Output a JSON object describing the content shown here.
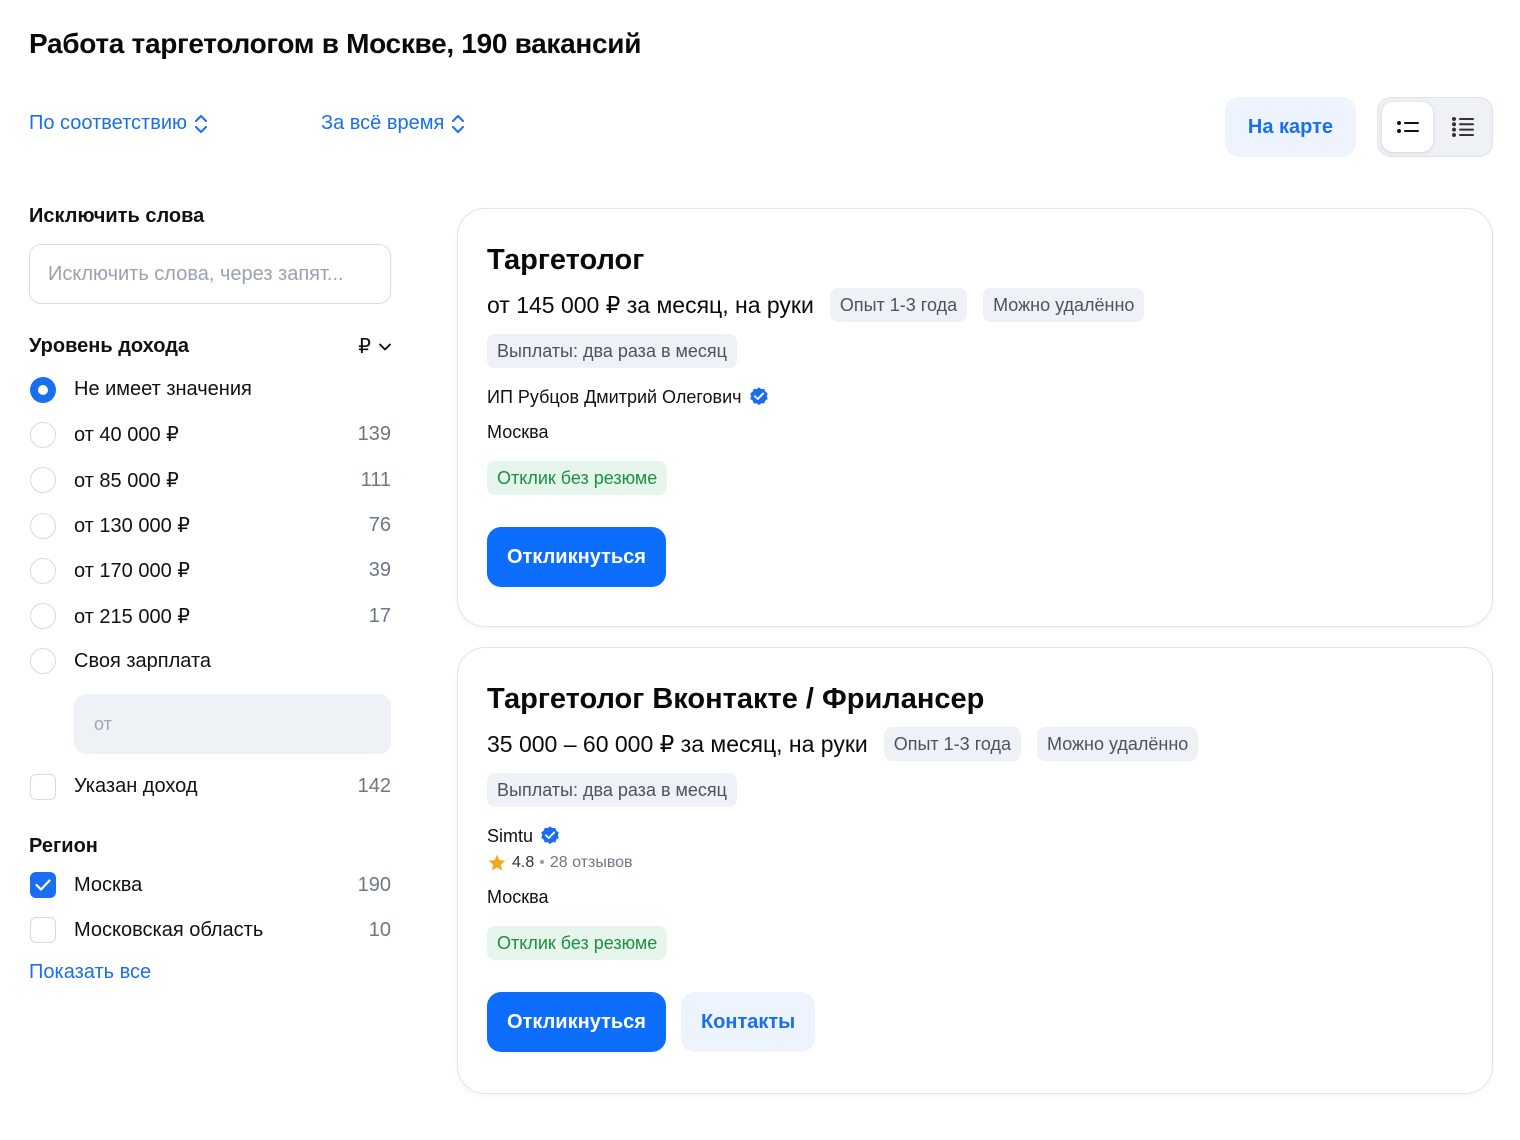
{
  "page": {
    "title": "Работа таргетологом в Москве, 190 вакансий"
  },
  "toolbar": {
    "sort_label": "По соответствию",
    "period_label": "За всё время",
    "map_button": "На карте",
    "view_modes": [
      "compact-list",
      "detailed-list"
    ],
    "active_view": "compact-list"
  },
  "filters": {
    "exclude": {
      "heading": "Исключить слова",
      "placeholder": "Исключить слова, через запят..."
    },
    "income": {
      "heading": "Уровень дохода",
      "currency": "₽",
      "options": [
        {
          "label": "Не имеет значения",
          "count": "",
          "checked": true
        },
        {
          "label": "от 40 000 ₽",
          "count": "139",
          "checked": false
        },
        {
          "label": "от 85 000 ₽",
          "count": "111",
          "checked": false
        },
        {
          "label": "от 130 000 ₽",
          "count": "76",
          "checked": false
        },
        {
          "label": "от 170 000 ₽",
          "count": "39",
          "checked": false
        },
        {
          "label": "от 215 000 ₽",
          "count": "17",
          "checked": false
        },
        {
          "label": "Своя зарплата",
          "count": "",
          "checked": false
        }
      ],
      "own_salary_placeholder": "от",
      "specified": {
        "label": "Указан доход",
        "count": "142",
        "checked": false
      }
    },
    "region": {
      "heading": "Регион",
      "options": [
        {
          "label": "Москва",
          "count": "190",
          "checked": true
        },
        {
          "label": "Московская область",
          "count": "10",
          "checked": false
        }
      ],
      "show_all": "Показать все"
    }
  },
  "vacancies": [
    {
      "title": "Таргетолог",
      "salary": "от 145 000 ₽ за месяц, на руки",
      "tags": [
        "Опыт 1-3 года",
        "Можно удалённо"
      ],
      "payout": "Выплаты: два раза в месяц",
      "company": "ИП Рубцов Дмитрий Олегович",
      "city": "Москва",
      "no_resume": "Отклик без резюме",
      "apply_button": "Откликнуться"
    },
    {
      "title": "Таргетолог Вконтакте / Фрилансер",
      "salary": "35 000 – 60 000 ₽ за месяц, на руки",
      "tags": [
        "Опыт 1-3 года",
        "Можно удалённо"
      ],
      "payout": "Выплаты: два раза в месяц",
      "company": "Simtu",
      "rating": "4.8",
      "reviews": "28 отзывов",
      "city": "Москва",
      "no_resume": "Отклик без резюме",
      "apply_button": "Откликнуться",
      "contacts_button": "Контакты"
    }
  ],
  "colors": {
    "accent": "#1a6ef0",
    "primary_button": "#0d6efd",
    "success_text": "#1d8f3e",
    "success_bg": "#e6f6ec",
    "star": "#f5a623"
  }
}
